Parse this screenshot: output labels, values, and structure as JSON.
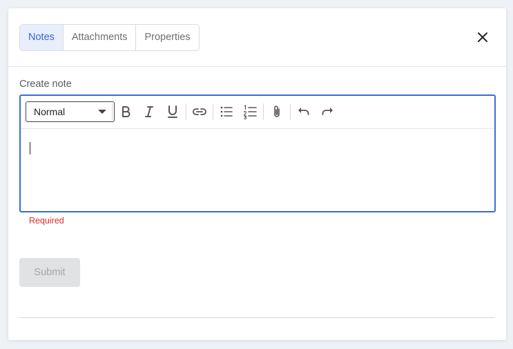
{
  "tabs": [
    {
      "label": "Notes",
      "active": true
    },
    {
      "label": "Attachments",
      "active": false
    },
    {
      "label": "Properties",
      "active": false
    }
  ],
  "header": {
    "close_icon": "close-icon"
  },
  "form": {
    "label": "Create note",
    "error": "Required",
    "submit_label": "Submit"
  },
  "editor": {
    "format_select": "Normal",
    "toolbar_icons": [
      "bold-icon",
      "italic-icon",
      "underline-icon",
      "link-icon",
      "bulleted-list-icon",
      "numbered-list-icon",
      "attachment-icon",
      "undo-icon",
      "redo-icon"
    ],
    "content": ""
  },
  "colors": {
    "accent": "#3b6ad4",
    "active_tab_bg": "#e9eefc",
    "error": "#d23030",
    "disabled_button_bg": "#e1e2e4"
  }
}
